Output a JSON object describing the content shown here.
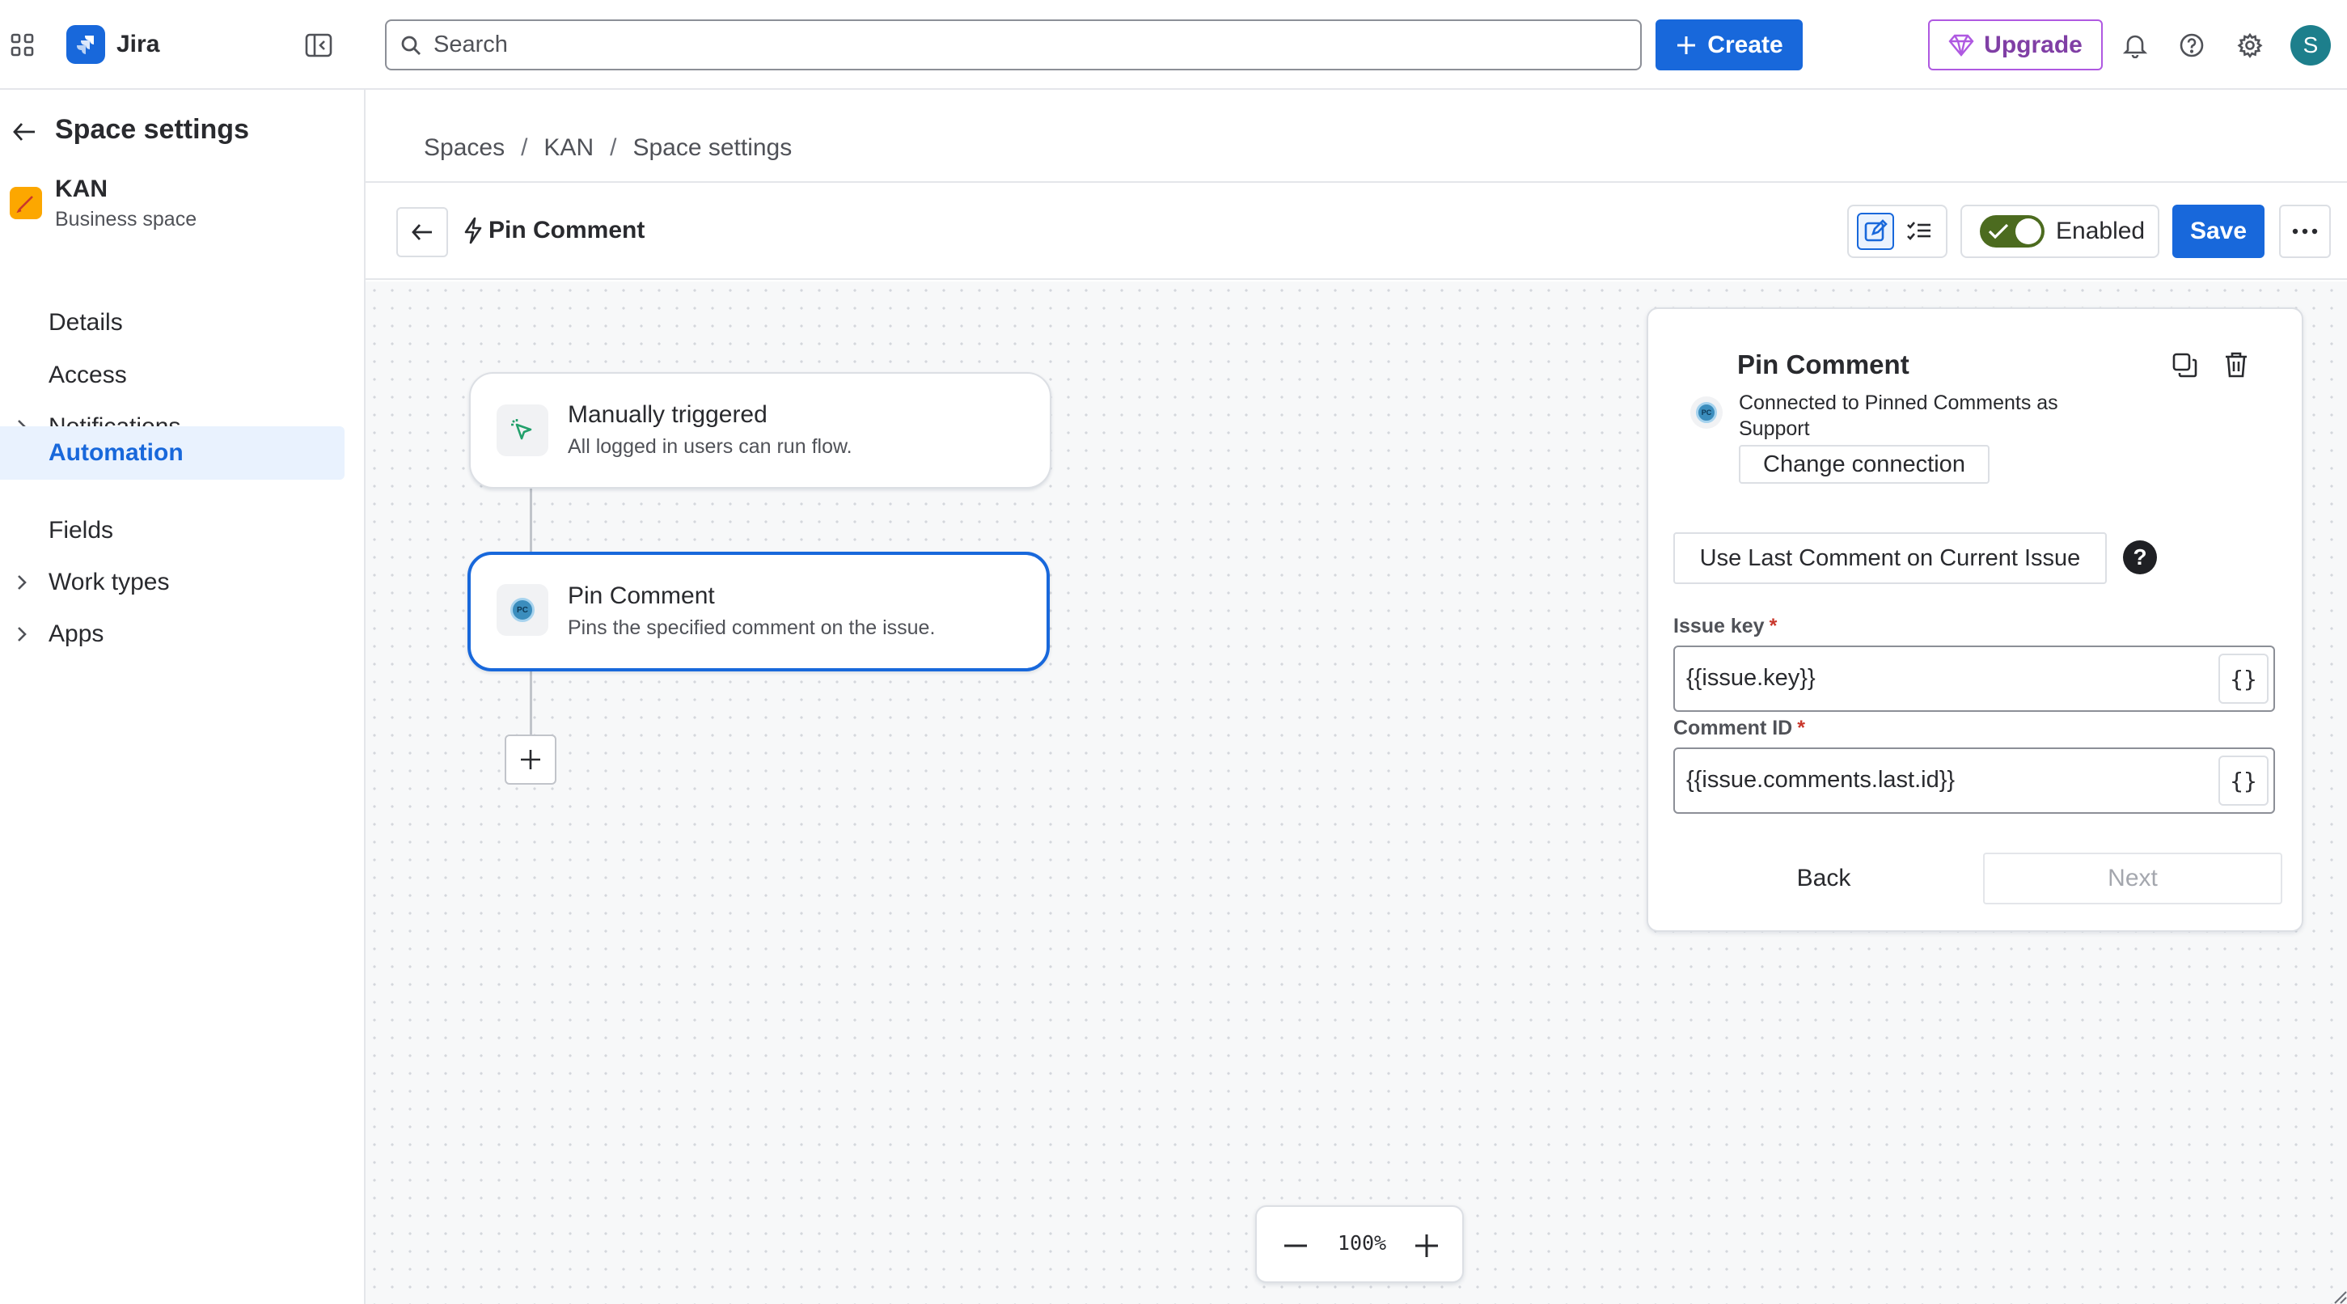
{
  "app": {
    "name": "Jira"
  },
  "topbar": {
    "search_placeholder": "Search",
    "create_label": "Create",
    "upgrade_label": "Upgrade",
    "avatar_initial": "S"
  },
  "sidebar": {
    "title": "Space settings",
    "project": {
      "name": "KAN",
      "type": "Business space"
    },
    "items": [
      {
        "label": "Details",
        "expandable": false,
        "active": false
      },
      {
        "label": "Access",
        "expandable": false,
        "active": false
      },
      {
        "label": "Notifications",
        "expandable": true,
        "active": false
      },
      {
        "label": "Automation",
        "expandable": false,
        "active": true
      },
      {
        "label": "Fields",
        "expandable": false,
        "active": false
      },
      {
        "label": "Work types",
        "expandable": true,
        "active": false
      },
      {
        "label": "Apps",
        "expandable": true,
        "active": false
      }
    ]
  },
  "breadcrumb": [
    "Spaces",
    "KAN",
    "Space settings"
  ],
  "rule": {
    "name": "Pin Comment",
    "status_label": "Enabled",
    "enabled": true,
    "save_label": "Save"
  },
  "flow": {
    "trigger": {
      "title": "Manually triggered",
      "subtitle": "All logged in users can run flow.",
      "icon": "cursor-click-icon"
    },
    "action": {
      "title": "Pin Comment",
      "subtitle": "Pins the specified comment on the issue.",
      "badge": "PC"
    }
  },
  "panel": {
    "title": "Pin Comment",
    "connection_text": "Connected to Pinned Comments as Support",
    "change_connection_label": "Change connection",
    "use_last_label": "Use Last Comment on Current Issue",
    "help_glyph": "?",
    "fields": [
      {
        "label": "Issue key",
        "required": true,
        "value": "{{issue.key}}"
      },
      {
        "label": "Comment ID",
        "required": true,
        "value": "{{issue.comments.last.id}}"
      }
    ],
    "brace_glyph": "{}",
    "back_label": "Back",
    "next_label": "Next"
  },
  "zoom": {
    "level": "100%"
  },
  "colors": {
    "brand_blue": "#1868db",
    "upgrade_purple": "#af59e1",
    "toggle_green": "#4c6b1f",
    "active_nav_bg": "#e9f2fe",
    "required_red": "#c9372c"
  }
}
